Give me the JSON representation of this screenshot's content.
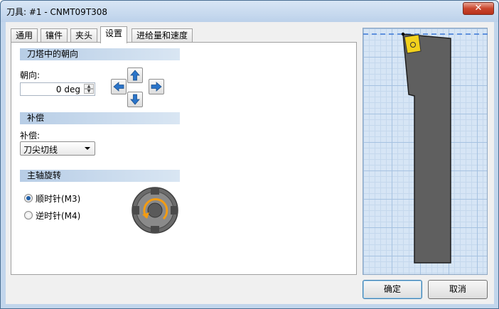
{
  "window": {
    "title": "刀具: #1 - CNMT09T308",
    "close_glyph": "✕"
  },
  "tabs": [
    {
      "label": "通用",
      "active": false
    },
    {
      "label": "镶件",
      "active": false
    },
    {
      "label": "夹头",
      "active": false
    },
    {
      "label": "设置",
      "active": true
    },
    {
      "label": "进给量和速度",
      "active": false
    }
  ],
  "orientation": {
    "header": "刀塔中的朝向",
    "field_label": "朝向:",
    "value": "0 deg",
    "arrow_buttons": [
      "arrow-up-icon",
      "arrow-left-icon",
      "arrow-right-icon",
      "arrow-down-icon"
    ]
  },
  "compensation": {
    "header": "补偿",
    "field_label": "补偿:",
    "selected": "刀尖切线"
  },
  "spindle": {
    "header": "主轴旋转",
    "options": [
      {
        "label": "顺时针(M3)",
        "checked": true
      },
      {
        "label": "逆时针(M4)",
        "checked": false
      }
    ]
  },
  "buttons": {
    "ok": "确定",
    "cancel": "取消"
  },
  "colors": {
    "insert": "#f2d11c",
    "holder": "#5f5f5f",
    "accent_arrow": "#2a74c9",
    "guide_line": "#3b78d6"
  }
}
